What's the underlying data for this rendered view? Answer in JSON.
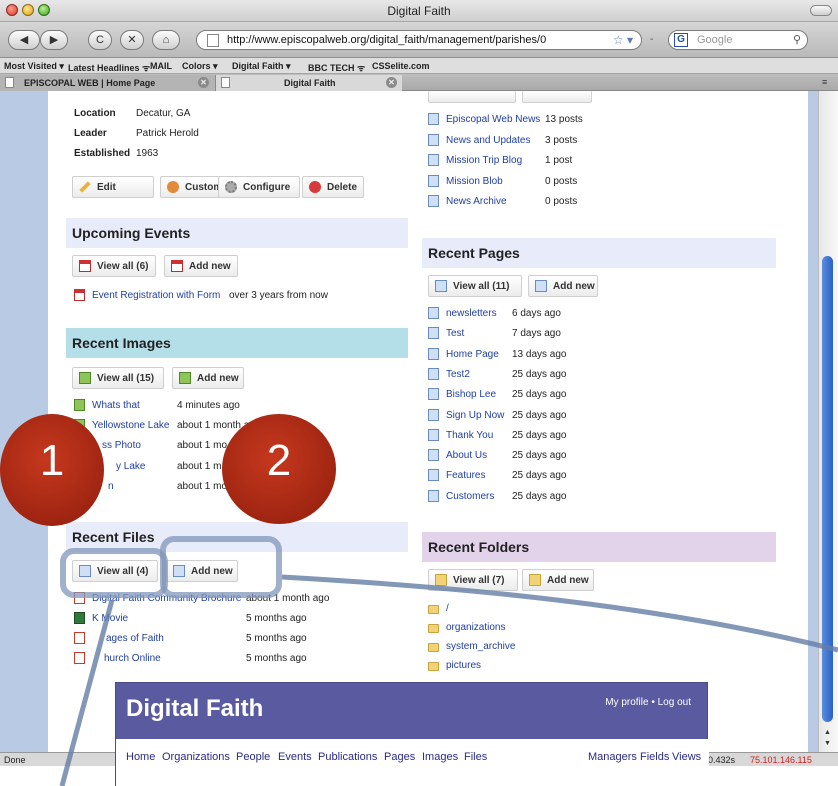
{
  "window": {
    "title": "Digital Faith"
  },
  "toolbar": {
    "url": "http://www.episcopalweb.org/digital_faith/management/parishes/0",
    "search_placeholder": "Google",
    "back": "◀",
    "forward": "▶",
    "reload": "C",
    "stop": "✕",
    "home": "⌂"
  },
  "bookmarks": [
    "Most Visited ▾",
    "Latest Headlines ᯤ",
    "MAIL",
    "Colors ▾",
    "Digital Faith ▾",
    "BBC TECH ᯤ",
    "CSSelite.com"
  ],
  "tabs": [
    {
      "label": "EPISCOPAL WEB | Home Page"
    },
    {
      "label": "Digital Faith"
    }
  ],
  "parish": {
    "rows": [
      {
        "label": "Location",
        "value": "Decatur, GA"
      },
      {
        "label": "Leader",
        "value": "Patrick Herold"
      },
      {
        "label": "Established",
        "value": "1963"
      }
    ],
    "actions": [
      "Edit",
      "Customize",
      "Configure",
      "Delete"
    ]
  },
  "events": {
    "title": "Upcoming Events",
    "view_all": "View all (6)",
    "add_new": "Add new",
    "items": [
      {
        "name": "Event Registration with Form",
        "when": "over 3 years from now"
      }
    ]
  },
  "images": {
    "title": "Recent Images",
    "view_all": "View all (15)",
    "add_new": "Add new",
    "items": [
      {
        "name": "Whats that",
        "when": "4 minutes ago"
      },
      {
        "name": "Yellowstone Lake",
        "when": "about 1 month ago"
      },
      {
        "name": "ss Photo",
        "when": "about 1 mo"
      },
      {
        "name": "y Lake",
        "when": "about 1 m"
      },
      {
        "name": "n",
        "when": "about 1 mo"
      }
    ]
  },
  "files": {
    "title": "Recent Files",
    "view_all": "View all (4)",
    "add_new": "Add new",
    "items": [
      {
        "name": "Digital Faith Community Brochure",
        "when": "about 1 month ago"
      },
      {
        "name": "K   Movie",
        "when": "5 months ago"
      },
      {
        "name": "ages of Faith",
        "when": "5 months ago"
      },
      {
        "name": "hurch Online",
        "when": "5 months ago"
      }
    ]
  },
  "blogs": {
    "items": [
      {
        "name": "Episcopal Web News",
        "count": "13 posts"
      },
      {
        "name": "News and Updates",
        "count": "3 posts"
      },
      {
        "name": "Mission Trip Blog",
        "count": "1 post"
      },
      {
        "name": "Mission Blob",
        "count": "0 posts"
      },
      {
        "name": "News Archive",
        "count": "0 posts"
      }
    ]
  },
  "pages": {
    "title": "Recent Pages",
    "view_all": "View all (11)",
    "add_new": "Add new",
    "items": [
      {
        "name": "newsletters",
        "when": "6 days ago"
      },
      {
        "name": "Test",
        "when": "7 days ago"
      },
      {
        "name": "Home Page",
        "when": "13 days ago"
      },
      {
        "name": "Test2",
        "when": "25 days ago"
      },
      {
        "name": "Bishop Lee",
        "when": "25 days ago"
      },
      {
        "name": "Sign Up Now",
        "when": "25 days ago"
      },
      {
        "name": "Thank You",
        "when": "25 days ago"
      },
      {
        "name": "About Us",
        "when": "25 days ago"
      },
      {
        "name": "Features",
        "when": "25 days ago"
      },
      {
        "name": "Customers",
        "when": "25 days ago"
      }
    ]
  },
  "folders": {
    "title": "Recent Folders",
    "view_all": "View all (7)",
    "add_new": "Add new",
    "items": [
      "/",
      "organizations",
      "system_archive",
      "pictures"
    ]
  },
  "status": {
    "left": "Done",
    "time": "0.432s",
    "ip": "75.101.146.115"
  },
  "annotations": {
    "one": "1",
    "two": "2"
  },
  "inset": {
    "title": "Digital Faith",
    "profile": "My profile • Log out",
    "nav_left": [
      "Home",
      "Organizations",
      "People",
      "Events",
      "Publications",
      "Pages",
      "Images",
      "Files"
    ],
    "nav_right": [
      "Managers",
      "Fields",
      "Views"
    ]
  },
  "colors": {
    "accent": "#1f3fa0",
    "section_blue": "#e8ebfa",
    "section_cyan": "#b5dfe8",
    "section_purple": "#e2d2ea",
    "annotation_red": "#a82818"
  }
}
